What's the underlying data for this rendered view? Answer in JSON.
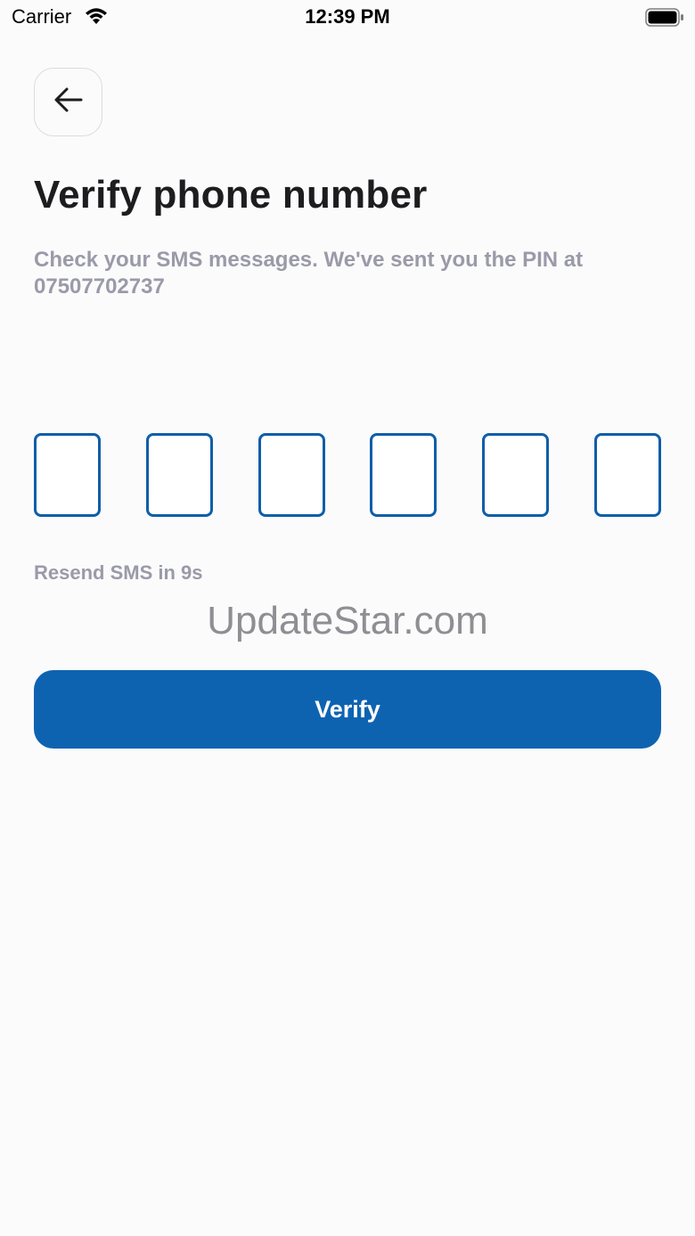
{
  "status_bar": {
    "carrier": "Carrier",
    "time": "12:39 PM"
  },
  "header": {
    "back_icon": "arrow-left-icon"
  },
  "main": {
    "title": "Verify phone number",
    "subtitle": "Check your SMS messages. We've sent you the PIN at 07507702737",
    "pin_boxes": [
      "",
      "",
      "",
      "",
      "",
      ""
    ],
    "resend_text": "Resend SMS in 9s",
    "watermark": "UpdateStar.com",
    "verify_label": "Verify"
  },
  "colors": {
    "accent": "#0e63b1",
    "pin_border": "#0e5ea8",
    "muted_text": "#9a9aa8",
    "background": "#fbfbfc"
  }
}
